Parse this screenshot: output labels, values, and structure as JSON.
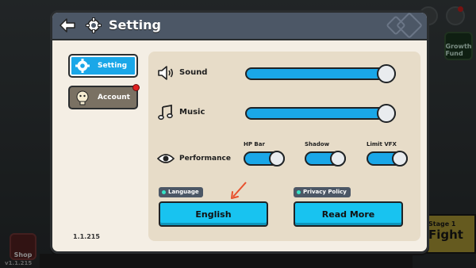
{
  "background": {
    "shop_label": "Shop",
    "growth_label": "Growth Fund",
    "version_corner": "v1.1.215",
    "fight_stage": "Stage 1",
    "fight_label": "Fight"
  },
  "modal": {
    "title": "Setting",
    "tabs": [
      {
        "label": "Setting",
        "icon": "gear-icon",
        "active": true
      },
      {
        "label": "Account",
        "icon": "avatar-icon",
        "active": false,
        "notification": true
      }
    ],
    "version": "1.1.215"
  },
  "settings": {
    "sound": {
      "label": "Sound",
      "icon": "speaker-icon",
      "level": 1.0
    },
    "music": {
      "label": "Music",
      "icon": "music-note-icon",
      "level": 1.0
    },
    "performance": {
      "label": "Performance",
      "icon": "eye-icon",
      "toggles": [
        {
          "label": "HP Bar",
          "on": true
        },
        {
          "label": "Shadow",
          "on": true
        },
        {
          "label": "Limit VFX",
          "on": true
        }
      ]
    },
    "language": {
      "chip": "Language",
      "button": "English"
    },
    "privacy": {
      "chip": "Privacy Policy",
      "button": "Read More"
    }
  },
  "colors": {
    "accent": "#1aa7e8",
    "header": "#4c5766",
    "panel": "#e7dcc8",
    "modal": "#f4eee4",
    "arrow": "#e8502c"
  }
}
